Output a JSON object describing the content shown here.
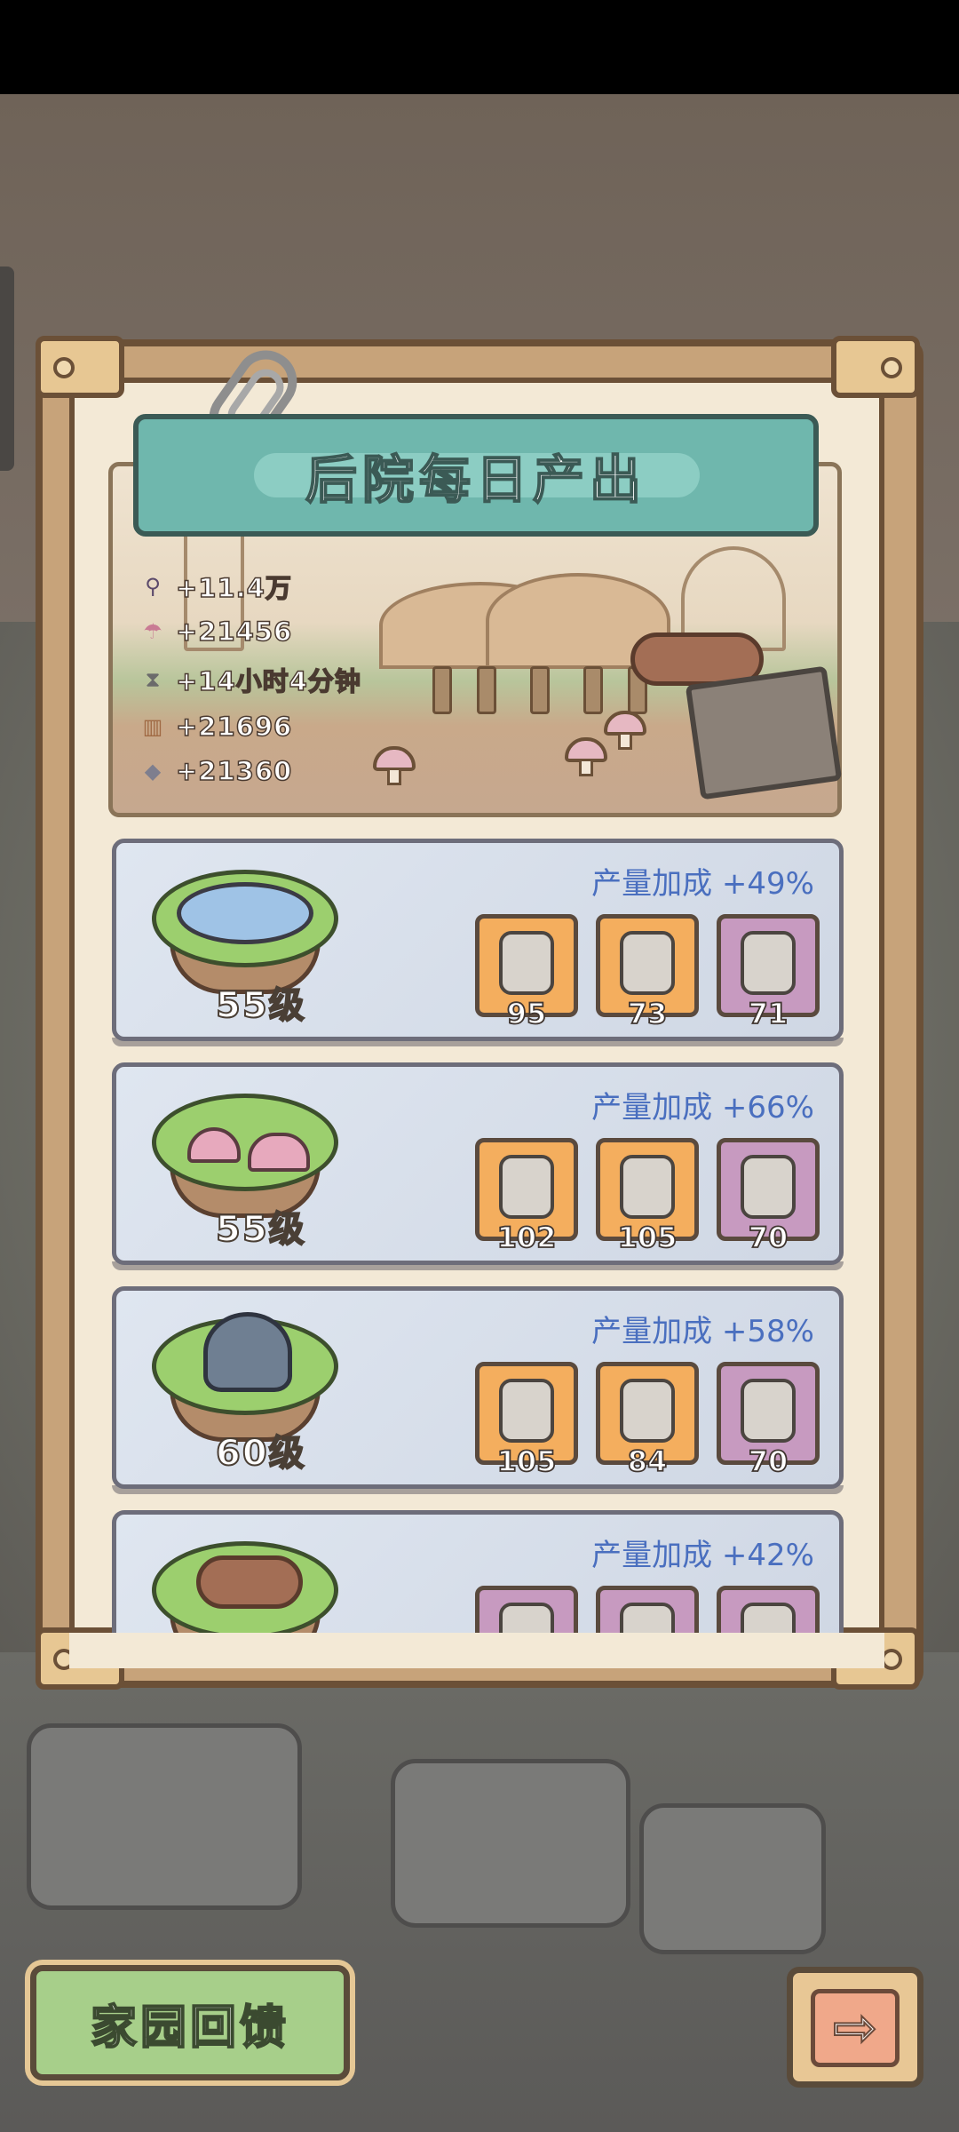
{
  "panel": {
    "title": "后院每日产出",
    "stats": [
      {
        "icon": "magnifier-icon",
        "value": "+11.4万"
      },
      {
        "icon": "mushroom-icon",
        "value": "+21456"
      },
      {
        "icon": "hourglass-icon",
        "value": "+14小时4分钟"
      },
      {
        "icon": "wood-icon",
        "value": "+21696"
      },
      {
        "icon": "stone-icon",
        "value": "+21360"
      }
    ]
  },
  "facilities": [
    {
      "name": "pond",
      "bonus": "产量加成  +49%",
      "level": "55级",
      "items": [
        {
          "count": "95",
          "rarity": "orange"
        },
        {
          "count": "73",
          "rarity": "orange"
        },
        {
          "count": "71",
          "rarity": "purple"
        }
      ]
    },
    {
      "name": "mushroom-farm",
      "bonus": "产量加成  +66%",
      "level": "55级",
      "items": [
        {
          "count": "102",
          "rarity": "orange"
        },
        {
          "count": "105",
          "rarity": "orange"
        },
        {
          "count": "70",
          "rarity": "purple"
        }
      ]
    },
    {
      "name": "workshop",
      "bonus": "产量加成  +58%",
      "level": "60级",
      "items": [
        {
          "count": "105",
          "rarity": "orange"
        },
        {
          "count": "84",
          "rarity": "orange"
        },
        {
          "count": "70",
          "rarity": "purple"
        }
      ]
    },
    {
      "name": "lumber-yard",
      "bonus": "产量加成  +42%",
      "level": "",
      "items": [
        {
          "count": "",
          "rarity": "purple"
        },
        {
          "count": "",
          "rarity": "purple"
        },
        {
          "count": "",
          "rarity": "purple"
        }
      ]
    }
  ],
  "buttons": {
    "home_feedback": "家园回馈",
    "next": "⇨"
  },
  "colors": {
    "banner": "#6fb7ad",
    "bonus_text": "#4a6fbf",
    "item_orange": "#f4ae5e",
    "item_purple": "#c79ac0"
  }
}
